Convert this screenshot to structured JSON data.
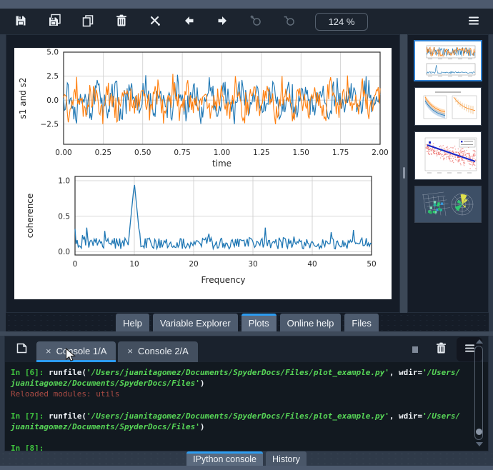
{
  "window": {
    "app": "Spyder",
    "zoom_level": "124 %"
  },
  "toolbar": {
    "icons": [
      "save-plot-icon",
      "save-all-plots-icon",
      "copy-plot-icon",
      "remove-plot-icon",
      "close-all-plots-icon",
      "previous-plot-icon",
      "next-plot-icon",
      "zoom-in-icon",
      "zoom-out-icon",
      "options-menu-icon"
    ],
    "zoom_in_enabled": false,
    "zoom_out_enabled": false
  },
  "plots_pane": {
    "chart_data": [
      {
        "type": "line",
        "title": "",
        "xlabel": "time",
        "ylabel": "s1 and s2",
        "xlim": [
          0,
          2
        ],
        "ylim": [
          -4.6,
          5.0
        ],
        "grid": true,
        "xticks": [
          "0.00",
          "0.25",
          "0.50",
          "0.75",
          "1.00",
          "1.25",
          "1.50",
          "1.75",
          "2.00"
        ],
        "yticks": [
          {
            "value": 5.0,
            "label": "5.0"
          },
          {
            "value": 2.5,
            "label": "2.5"
          },
          {
            "value": 0.0,
            "label": "0.0"
          },
          {
            "value": -2.5,
            "label": "−2.5"
          }
        ],
        "series": [
          {
            "name": "s1",
            "color": "#1f77b4",
            "kind": "noisy-sine",
            "signal_freq_hz": 10,
            "amplitude": 1.0,
            "noise": 1.9,
            "phase": 0.3,
            "seed": 13,
            "points": 340
          },
          {
            "name": "s2",
            "color": "#ff7f0e",
            "kind": "noisy-sine",
            "signal_freq_hz": 10,
            "amplitude": 1.0,
            "noise": 1.9,
            "phase": 2.2,
            "seed": 47,
            "points": 340
          }
        ]
      },
      {
        "type": "line",
        "title": "",
        "xlabel": "Frequency",
        "ylabel": "coherence",
        "xlim": [
          0,
          50
        ],
        "ylim": [
          -0.045,
          1.06
        ],
        "grid": true,
        "xticks": [
          "0",
          "10",
          "20",
          "30",
          "40",
          "50"
        ],
        "yticks": [
          {
            "value": 1.0,
            "label": "1.0"
          },
          {
            "value": 0.5,
            "label": "0.5"
          },
          {
            "value": 0.0,
            "label": "0.0"
          }
        ],
        "series": [
          {
            "name": "coherence",
            "color": "#1f77b4",
            "kind": "noise-floor-with-peak",
            "peak_x": 10,
            "peak_y": 0.97,
            "baseline_range": [
              0.02,
              0.35
            ],
            "seed": 91,
            "points": 280
          }
        ]
      }
    ],
    "thumbnails": [
      {
        "kind": "signals-coherence",
        "label": "signals and coherence figure",
        "selected": true
      },
      {
        "kind": "decay-bands",
        "label": "decay curves with confidence bands",
        "selected": false
      },
      {
        "kind": "scatter-fit",
        "label": "red scatter with blue model fit",
        "selected": false
      },
      {
        "kind": "dark-3d-polar",
        "label": "3d voxels and polar bars on dark style",
        "selected": false
      }
    ]
  },
  "pane_tabs": {
    "items": [
      {
        "label": "Help"
      },
      {
        "label": "Variable Explorer"
      },
      {
        "label": "Plots"
      },
      {
        "label": "Online help"
      },
      {
        "label": "Files"
      }
    ],
    "selected": "Plots"
  },
  "console": {
    "tabs": [
      {
        "label": "Console 1/A",
        "selected": true
      },
      {
        "label": "Console 2/A",
        "selected": false
      }
    ],
    "controls": [
      "new-console-icon",
      "stop-icon",
      "trash-icon",
      "options-menu-icon"
    ],
    "lines": [
      {
        "segments": [
          {
            "text": "In [6]: ",
            "style": "prompt"
          },
          {
            "text": "runfile(",
            "style": "code"
          },
          {
            "text": "'/Users/juanitagomez/Documents/SpyderDocs/Files/plot_example.py'",
            "style": "string"
          },
          {
            "text": ", wdir=",
            "style": "code"
          },
          {
            "text": "'/Users/",
            "style": "string"
          }
        ]
      },
      {
        "segments": [
          {
            "text": "juanitagomez/Documents/SpyderDocs/Files'",
            "style": "string"
          },
          {
            "text": ")",
            "style": "code"
          }
        ]
      },
      {
        "segments": [
          {
            "text": "Reloaded modules: utils",
            "style": "error"
          }
        ]
      },
      {
        "segments": []
      },
      {
        "segments": [
          {
            "text": "In [7]: ",
            "style": "prompt"
          },
          {
            "text": "runfile(",
            "style": "code"
          },
          {
            "text": "'/Users/juanitagomez/Documents/SpyderDocs/Files/plot_example.py'",
            "style": "string"
          },
          {
            "text": ", wdir=",
            "style": "code"
          },
          {
            "text": "'/Users/",
            "style": "string"
          }
        ]
      },
      {
        "segments": [
          {
            "text": "juanitagomez/Documents/SpyderDocs/Files'",
            "style": "string"
          },
          {
            "text": ")",
            "style": "code"
          }
        ]
      },
      {
        "segments": []
      },
      {
        "segments": [
          {
            "text": "In [8]: ",
            "style": "prompt"
          }
        ]
      }
    ]
  },
  "bottom_tabs": {
    "items": [
      {
        "label": "IPython console"
      },
      {
        "label": "History"
      }
    ],
    "selected": "IPython console"
  },
  "colors": {
    "accent_blue": "#2d9cf0",
    "thumbnail_selected_border": "#2e7fd0",
    "series_blue": "#1f77b4",
    "series_orange": "#ff7f0e",
    "prompt_green": "#3fc33f",
    "string_green": "#57d657",
    "error_red": "#a94b44",
    "panel_bg": "#151c27",
    "console_bg": "#121920",
    "toolbar_bg": "#1c242f"
  }
}
